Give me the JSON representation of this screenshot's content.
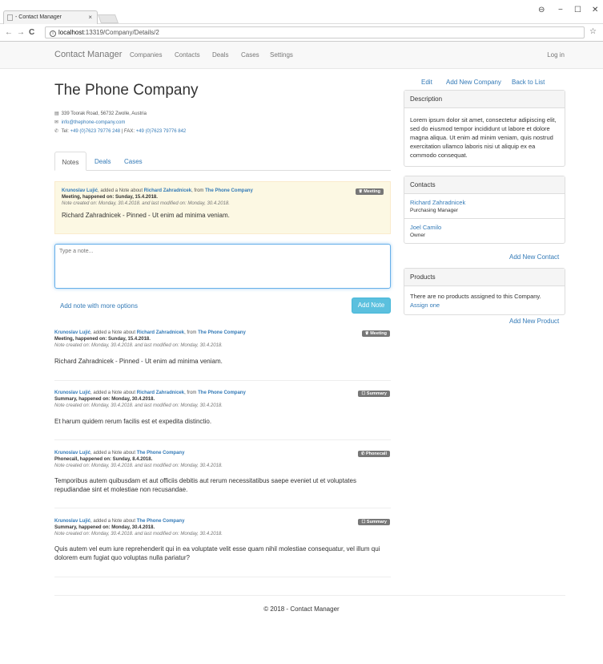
{
  "browser": {
    "tab_title": "- Contact Manager",
    "tab_close": "×",
    "url_host": "localhost",
    "url_rest": ":13319/Company/Details/2",
    "nav_back": "←",
    "nav_forward": "→",
    "nav_reload": "C",
    "info": "i",
    "star": "☆",
    "profile": "⊖",
    "minimize": "−",
    "maximize": "☐",
    "close": "✕"
  },
  "navbar": {
    "brand": "Contact Manager",
    "links": [
      "Companies",
      "Contacts",
      "Deals",
      "Cases",
      "Settings"
    ],
    "login": "Log in"
  },
  "company": {
    "name": "The Phone Company",
    "address": "339 Toorak Road, 56732 Zwolle, Austria",
    "email": "info@thephone-company.com",
    "phone_prefix": "Tel:",
    "phone": "+49 (0)7623 79776 248",
    "fax_sep": "| FAX:",
    "fax": "+49 (0)7623 79776 842",
    "icons": {
      "address": "▤",
      "email": "✉",
      "phone": "✆"
    }
  },
  "tabs": [
    "Notes",
    "Deals",
    "Cases"
  ],
  "pinned_note": {
    "author": "Krunoslav Lujić",
    "added_about": ", added a Note about",
    "contact": "Richard Zahradnicek",
    "from": ", from",
    "company": "The Phone Company",
    "happened": "Meeting, happened on: Sunday, 15.4.2018.",
    "created": "Note created on: Monday, 30.4.2018. and last modified on: Monday, 30.4.2018.",
    "text": "Richard Zahradnicek - Pinned - Ut enim ad minima veniam.",
    "badge": "Meeting",
    "badge_icon": "♛"
  },
  "note_input": {
    "placeholder": "Type a note...",
    "more_options": "Add note with more options",
    "add_button": "Add Note"
  },
  "notes": [
    {
      "author": "Krunoslav Lujić",
      "added_about": ", added a Note about",
      "contact": "Richard Zahradnicek",
      "from": ", from",
      "company": "The Phone Company",
      "happened": "Meeting, happened on: Sunday, 15.4.2018.",
      "created": "Note created on: Monday, 30.4.2018. and last modified on: Monday, 30.4.2018.",
      "text": "Richard Zahradnicek - Pinned - Ut enim ad minima veniam.",
      "badge": "♛ Meeting"
    },
    {
      "author": "Krunoslav Lujić",
      "added_about": ", added a Note about",
      "contact": "Richard Zahradnicek",
      "from": ", from",
      "company": "The Phone Company",
      "happened": "Summary, happened on: Monday, 30.4.2018.",
      "created": "Note created on: Monday, 30.4.2018. and last modified on: Monday, 30.4.2018.",
      "text": "Et harum quidem rerum facilis est et expedita distinctio.",
      "badge": "☐ Summary"
    },
    {
      "author": "Krunoslav Lujić",
      "added_about": ", added a Note about",
      "contact": "",
      "from": "",
      "company": "The Phone Company",
      "happened": "Phonecall, happened on: Sunday, 8.4.2018.",
      "created": "Note created on: Monday, 30.4.2018. and last modified on: Monday, 30.4.2018.",
      "text": "Temporibus autem quibusdam et aut officiis debitis aut rerum necessitatibus saepe eveniet ut et voluptates repudiandae sint et molestiae non recusandae.",
      "badge": "✆ Phonecall"
    },
    {
      "author": "Krunoslav Lujić",
      "added_about": ", added a Note about",
      "contact": "",
      "from": "",
      "company": "The Phone Company",
      "happened": "Summary, happened on: Monday, 30.4.2018.",
      "created": "Note created on: Monday, 30.4.2018. and last modified on: Monday, 30.4.2018.",
      "text": "Quis autem vel eum iure reprehenderit qui in ea voluptate velit esse quam nihil molestiae consequatur, vel illum qui dolorem eum fugiat quo voluptas nulla pariatur?",
      "badge": "☐ Summary"
    }
  ],
  "sidebar": {
    "edit": "Edit",
    "add_company": "Add New Company",
    "back": "Back to List",
    "description_title": "Description",
    "description": "Lorem ipsum dolor sit amet, consectetur adipiscing elit, sed do eiusmod tempor incididunt ut labore et dolore magna aliqua. Ut enim ad minim veniam, quis nostrud exercitation ullamco laboris nisi ut aliquip ex ea commodo consequat.",
    "contacts_title": "Contacts",
    "contacts": [
      {
        "name": "Richard Zahradnicek",
        "role": "Purchasing Manager"
      },
      {
        "name": "Joel Camilo",
        "role": "Owner"
      }
    ],
    "add_contact": "Add New Contact",
    "products_title": "Products",
    "products_empty": "There are no products assigned to this Company.",
    "assign": "Assign one",
    "add_product": "Add New Product"
  },
  "footer": "© 2018 - Contact Manager"
}
